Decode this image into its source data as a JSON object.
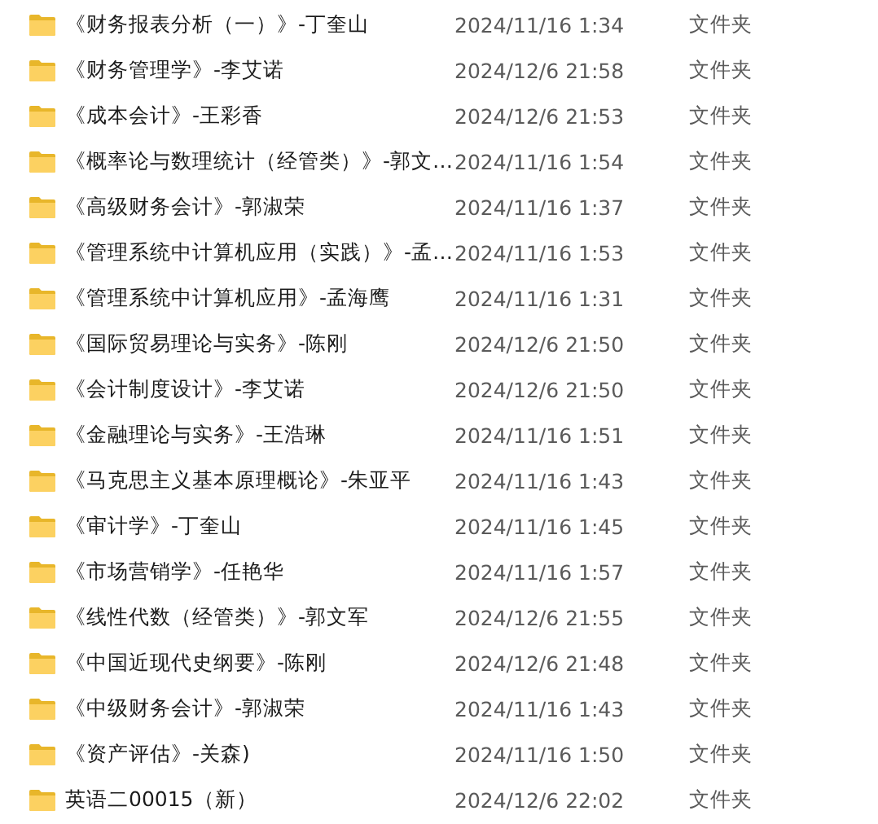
{
  "files": [
    {
      "name": "《财务报表分析（一）》-丁奎山",
      "modified": "2024/11/16 1:34",
      "type": "文件夹"
    },
    {
      "name": "《财务管理学》-李艾诺",
      "modified": "2024/12/6 21:58",
      "type": "文件夹"
    },
    {
      "name": "《成本会计》-王彩香",
      "modified": "2024/12/6 21:53",
      "type": "文件夹"
    },
    {
      "name": "《概率论与数理统计（经管类）》-郭文…",
      "modified": "2024/11/16 1:54",
      "type": "文件夹"
    },
    {
      "name": "《高级财务会计》-郭淑荣",
      "modified": "2024/11/16 1:37",
      "type": "文件夹"
    },
    {
      "name": "《管理系统中计算机应用（实践）》-孟…",
      "modified": "2024/11/16 1:53",
      "type": "文件夹"
    },
    {
      "name": "《管理系统中计算机应用》-孟海鹰",
      "modified": "2024/11/16 1:31",
      "type": "文件夹"
    },
    {
      "name": "《国际贸易理论与实务》-陈刚",
      "modified": "2024/12/6 21:50",
      "type": "文件夹"
    },
    {
      "name": "《会计制度设计》-李艾诺",
      "modified": "2024/12/6 21:50",
      "type": "文件夹"
    },
    {
      "name": "《金融理论与实务》-王浩琳",
      "modified": "2024/11/16 1:51",
      "type": "文件夹"
    },
    {
      "name": "《马克思主义基本原理概论》-朱亚平",
      "modified": "2024/11/16 1:43",
      "type": "文件夹"
    },
    {
      "name": "《审计学》-丁奎山",
      "modified": "2024/11/16 1:45",
      "type": "文件夹"
    },
    {
      "name": "《市场营销学》-任艳华",
      "modified": "2024/11/16 1:57",
      "type": "文件夹"
    },
    {
      "name": "《线性代数（经管类）》-郭文军",
      "modified": "2024/12/6 21:55",
      "type": "文件夹"
    },
    {
      "name": "《中国近现代史纲要》-陈刚",
      "modified": "2024/12/6 21:48",
      "type": "文件夹"
    },
    {
      "name": "《中级财务会计》-郭淑荣",
      "modified": "2024/11/16 1:43",
      "type": "文件夹"
    },
    {
      "name": "《资产评估》-关森)",
      "modified": "2024/11/16 1:50",
      "type": "文件夹"
    },
    {
      "name": "英语二00015（新）",
      "modified": "2024/12/6 22:02",
      "type": "文件夹"
    }
  ]
}
